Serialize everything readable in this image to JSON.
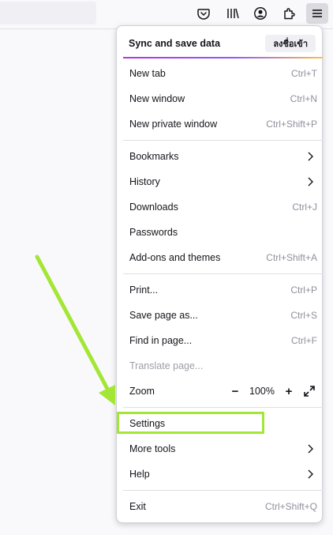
{
  "menu": {
    "sync_label": "Sync and save data",
    "signin_label": "ลงชื่อเข้า",
    "items": [
      {
        "label": "New tab",
        "shortcut": "Ctrl+T"
      },
      {
        "label": "New window",
        "shortcut": "Ctrl+N"
      },
      {
        "label": "New private window",
        "shortcut": "Ctrl+Shift+P"
      },
      {
        "label": "Bookmarks",
        "shortcut": ""
      },
      {
        "label": "History",
        "shortcut": ""
      },
      {
        "label": "Downloads",
        "shortcut": "Ctrl+J"
      },
      {
        "label": "Passwords",
        "shortcut": ""
      },
      {
        "label": "Add-ons and themes",
        "shortcut": "Ctrl+Shift+A"
      },
      {
        "label": "Print...",
        "shortcut": "Ctrl+P"
      },
      {
        "label": "Save page as...",
        "shortcut": "Ctrl+S"
      },
      {
        "label": "Find in page...",
        "shortcut": "Ctrl+F"
      },
      {
        "label": "Translate page...",
        "shortcut": ""
      },
      {
        "label": "Zoom",
        "shortcut": ""
      },
      {
        "label": "Settings",
        "shortcut": ""
      },
      {
        "label": "More tools",
        "shortcut": ""
      },
      {
        "label": "Help",
        "shortcut": ""
      },
      {
        "label": "Exit",
        "shortcut": "Ctrl+Shift+Q"
      }
    ],
    "zoom": {
      "minus": "−",
      "value": "100%",
      "plus": "+"
    }
  },
  "icons": {
    "toolbar": [
      "pocket-icon",
      "library-icon",
      "account-icon",
      "extensions-icon",
      "menu-icon"
    ],
    "zoom_expand": "fullscreen-icon"
  },
  "colors": {
    "highlight": "#a3e635",
    "arrow": "#a3e635"
  }
}
